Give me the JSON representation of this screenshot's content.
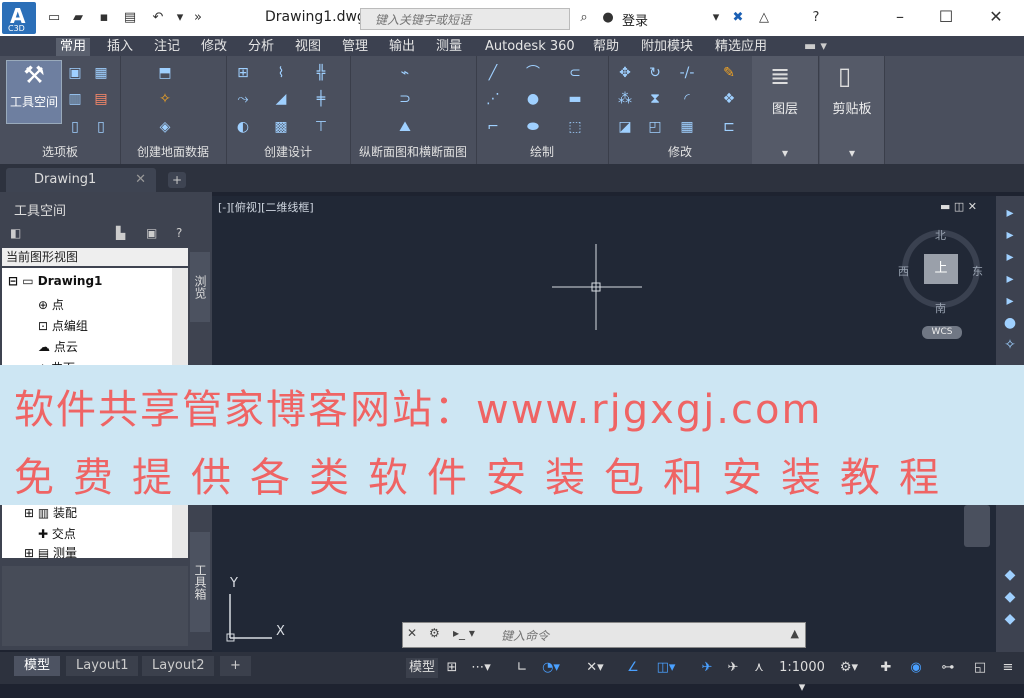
{
  "app": {
    "logo": "A",
    "logo_sub": "C3D"
  },
  "titlebar": {
    "document": "Drawing1.dwg",
    "search_placeholder": "键入关键字或短语",
    "login": "登录",
    "accent": "#2b6fb8"
  },
  "ribbon_tabs": [
    "常用",
    "插入",
    "注记",
    "修改",
    "分析",
    "视图",
    "管理",
    "输出",
    "测量",
    "Autodesk 360",
    "帮助",
    "附加模块",
    "精选应用"
  ],
  "ribbon_panels": {
    "palettes": {
      "label": "选项板",
      "big_button": "工具空间"
    },
    "ground_data": {
      "label": "创建地面数据"
    },
    "design": {
      "label": "创建设计"
    },
    "profile": {
      "label": "纵断面图和横断面图"
    },
    "draw": {
      "label": "绘制"
    },
    "modify": {
      "label": "修改"
    },
    "layers": {
      "label": "图层"
    },
    "clipboard": {
      "label": "剪贴板"
    }
  },
  "doc_tabs": {
    "active": "Drawing1"
  },
  "toolspace": {
    "title": "工具空间",
    "view": "当前图形视图",
    "vtab_browse": "浏览",
    "vtab_toolbox": "工具箱",
    "tree": [
      {
        "label": "Drawing1",
        "bold": true
      },
      {
        "label": "点"
      },
      {
        "label": "点编组"
      },
      {
        "label": "点云"
      },
      {
        "label": "曲面"
      },
      {
        "label": "装配"
      },
      {
        "label": "交点"
      },
      {
        "label": "测量"
      }
    ]
  },
  "viewport": {
    "label": "[-][俯视][二维线框]",
    "viewcube": {
      "top": "上",
      "north": "北",
      "south": "南",
      "east": "东",
      "west": "西"
    },
    "wcs": "WCS",
    "ucs_x": "X",
    "ucs_y": "Y"
  },
  "banner": {
    "line1": "软件共享管家博客网站：www.rjgxgj.com",
    "line2": "免费提供各类软件安装包和安装教程",
    "text_color": "#ef6464",
    "bg_color": "#cde6f3"
  },
  "command": {
    "placeholder": "键入命令"
  },
  "statusbar": {
    "layout_tabs": [
      "模型",
      "Layout1",
      "Layout2"
    ],
    "model_button": "模型",
    "scale": "1:1000"
  }
}
